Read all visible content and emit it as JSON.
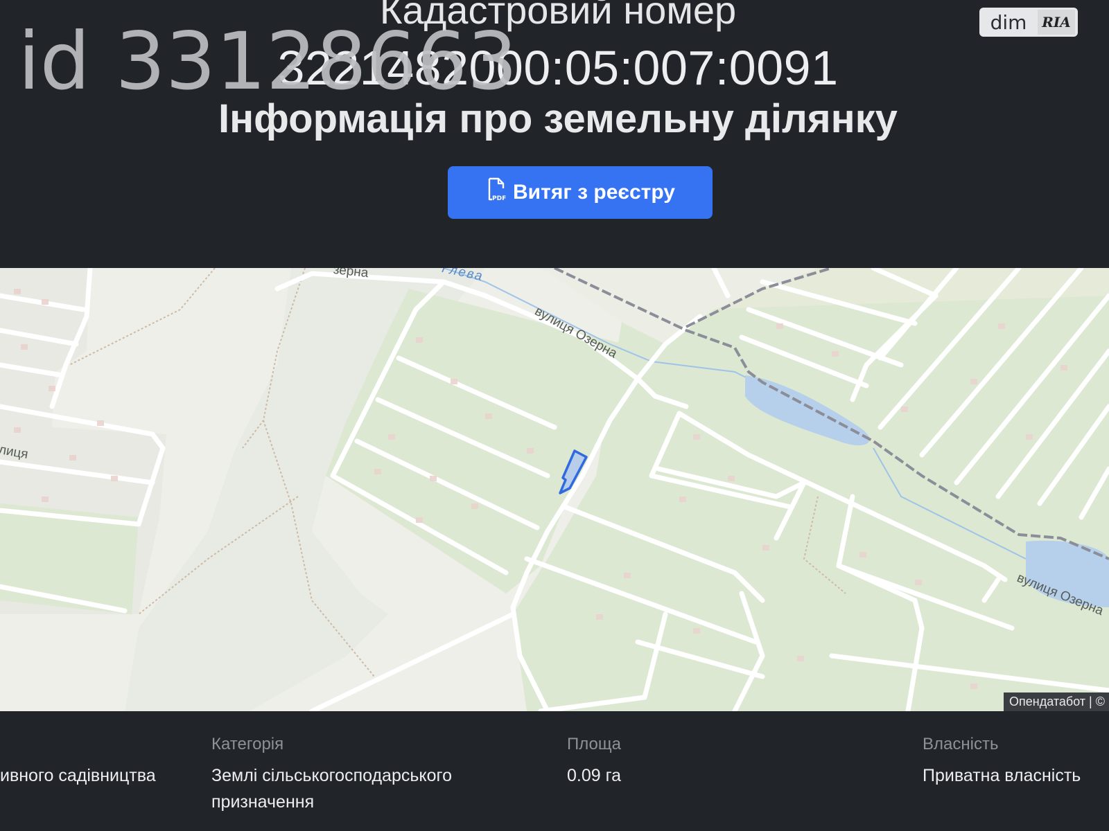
{
  "header": {
    "title_label": "Кадастровий номер",
    "cadastral_number": "3221482000:05:007:0091",
    "subtitle": "Інформація про земельну ділянку",
    "listing_id": "id 33128663",
    "brand_dim": "dim",
    "brand_ria": "RIA",
    "pdf_button_label": "Витяг з реєстру",
    "pdf_icon": "pdf-file-icon"
  },
  "map": {
    "labels": {
      "street_top": "вулиця Озерна",
      "street_right": "вулиця Озерна",
      "street_left": "лиця",
      "street_topleft": "зерна",
      "river": "Глева"
    },
    "attribution": "Опендатабот | ©",
    "colors": {
      "garden": "#dde8d2",
      "road": "#ffffff",
      "water": "#b6cfea",
      "parcel_outline": "#2f6ae0",
      "railway": "#8b8d98"
    }
  },
  "info": {
    "purpose_value": "ивного садівництва",
    "category_label": "Категорія",
    "category_value": "Землі сільськогосподарського призначення",
    "area_label": "Площа",
    "area_value": "0.09 га",
    "ownership_label": "Власність",
    "ownership_value": "Приватна власність"
  }
}
